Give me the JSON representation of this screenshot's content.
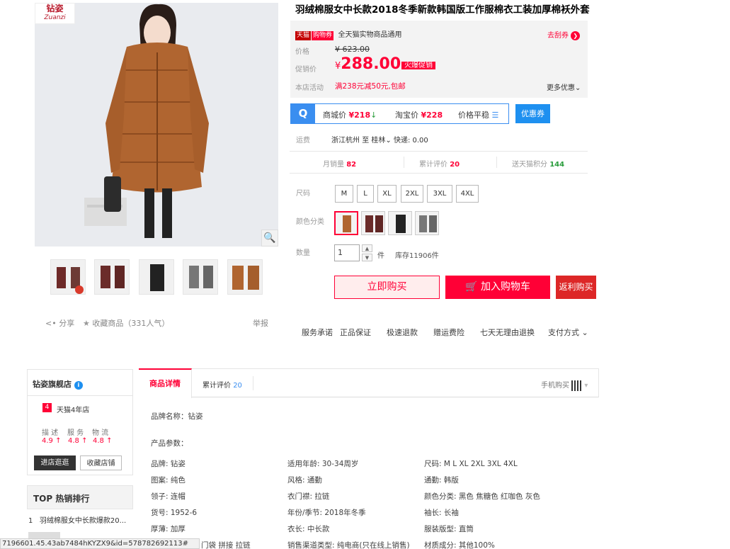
{
  "gallery": {
    "brand_logo_cn": "钻姿",
    "brand_logo_en": "Zuanzi",
    "share_label": "分享",
    "favorite_label": "收藏商品",
    "favorite_count": "（331人气）",
    "report_label": "举报"
  },
  "product": {
    "title": "羽绒棉服女中长款2018冬季新款韩国版工作服棉衣工装加厚棉袄外套",
    "promo_tag_tmall": "天猫",
    "promo_tag_voucher": "购物券",
    "promo_text": "全天猫实物商品通用",
    "promo_link": "去刮券",
    "price_label": "价格",
    "original_price": "¥ 623.00",
    "sale_label": "促销价",
    "currency": "¥",
    "sale_price": "288.00",
    "hot_badge": "火爆促销",
    "shop_activity_label": "本店活动",
    "shop_activity": "满238元减50元,包邮",
    "more_deals": "更多优惠"
  },
  "compare": {
    "mall_label": "商城价",
    "mall_price": "¥218",
    "taobao_label": "淘宝价",
    "taobao_price": "¥228",
    "trend_label": "价格平稳",
    "coupon_label": "优惠券"
  },
  "shipping": {
    "label": "运费",
    "from": "浙江杭州",
    "to_word": "至",
    "to": "桂林",
    "express": "快递: 0.00"
  },
  "stats": {
    "monthly_label": "月销量",
    "monthly_value": "82",
    "reviews_label": "累计评价",
    "reviews_value": "20",
    "points_label": "送天猫积分",
    "points_value": "144"
  },
  "options": {
    "size_label": "尺码",
    "sizes": [
      "M",
      "L",
      "XL",
      "2XL",
      "3XL",
      "4XL"
    ],
    "color_label": "颜色分类",
    "qty_label": "数量",
    "qty_value": "1",
    "unit": "件",
    "stock": "库存11906件"
  },
  "actions": {
    "buy_now": "立即购买",
    "add_cart": "加入购物车",
    "redirect": "返利购买"
  },
  "services": {
    "label": "服务承诺",
    "items": [
      "正品保证",
      "极速退款",
      "赠运费险",
      "七天无理由退换"
    ],
    "payment": "支付方式"
  },
  "shop": {
    "name": "钻姿旗舰店",
    "badge_years": "4",
    "years_text": "天猫4年店",
    "ratings_header": [
      "描 述",
      "服 务",
      "物 流"
    ],
    "ratings": [
      "4.9",
      "4.8",
      "4.8"
    ],
    "enter_shop": "进店逛逛",
    "fav_shop": "收藏店铺",
    "top_header": "TOP 热销排行",
    "top_item_1": "羽绒棉服女中长款爆款20..."
  },
  "tabs": {
    "detail": "商品详情",
    "reviews": "累计评价",
    "reviews_count": "20",
    "mobile_buy": "手机购买"
  },
  "details": {
    "brand_name_line": "品牌名称：钻姿",
    "params_header": "产品参数：",
    "params": [
      [
        "品牌: 钻姿",
        "适用年龄: 30-34周岁",
        "尺码: M L XL 2XL 3XL 4XL"
      ],
      [
        "图案: 纯色",
        "风格: 通勤",
        "通勤: 韩版"
      ],
      [
        "领子: 连帽",
        "衣门襟: 拉链",
        "颜色分类: 黑色 焦糖色 红咖色 灰色"
      ],
      [
        "货号: 1952-6",
        "年份/季节: 2018年冬季",
        "袖长: 长袖"
      ],
      [
        "厚薄: 加厚",
        "衣长: 中长款",
        "服装版型: 直筒"
      ],
      [
        "门袋 拼接 拉链",
        "销售渠道类型: 纯电商(只在线上销售)",
        "材质成分: 其他100%"
      ]
    ]
  },
  "status_bar": {
    "url": "7196601.45.43ab7484hKYZX9&id=578782692113#"
  }
}
